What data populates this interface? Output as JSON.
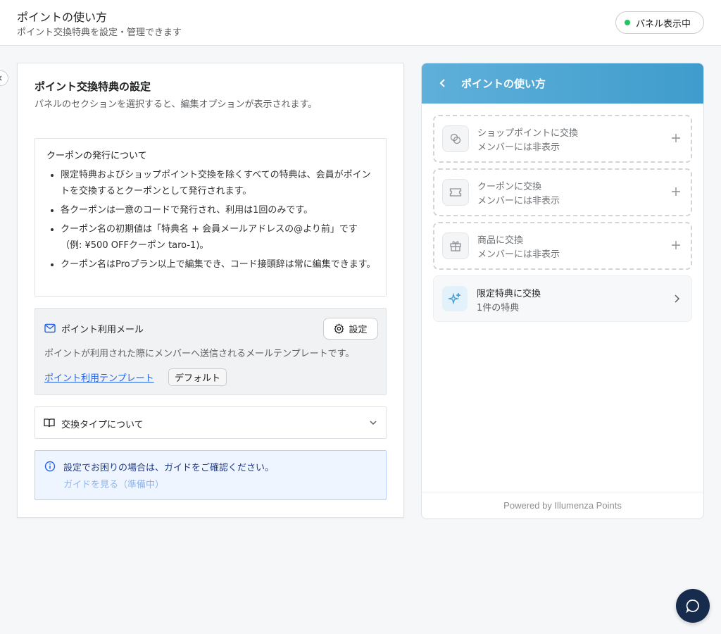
{
  "topbar": {
    "title": "ポイントの使い方",
    "subtitle": "ポイント交換特典を設定・管理できます",
    "status": "パネル表示中",
    "status_color": "#22c55e"
  },
  "settings": {
    "title": "ポイント交換特典の設定",
    "description": "パネルのセクションを選択すると、編集オプションが表示されます。",
    "coupon": {
      "heading": "クーポンの発行について",
      "items": [
        "限定特典およびショップポイント交換を除くすべての特典は、会員がポイントを交換するとクーポンとして発行されます。",
        "各クーポンは一意のコードで発行され、利用は1回のみです。",
        "クーポン名の初期値は「特典名 + 会員メールアドレスの@より前」です（例: ¥500 OFFクーポン taro-1)。",
        "クーポン名はProプラン以上で編集でき、コード接頭辞は常に編集できます。"
      ]
    },
    "email": {
      "icon": "mail-icon",
      "title": "ポイント利用メール",
      "settings_label": "設定",
      "description": "ポイントが利用された際にメンバーへ送信されるメールテンプレートです。",
      "template_link": "ポイント利用テンプレート",
      "badge": "デフォルト"
    },
    "exchange_types": {
      "icon": "book-icon",
      "label": "交換タイプについて"
    },
    "info": {
      "icon": "info-icon",
      "message": "設定でお困りの場合は、ガイドをご確認ください。",
      "guide_link": "ガイドを見る（準備中）"
    }
  },
  "panel": {
    "title": "ポイントの使い方",
    "header_color": "#4ba6d4",
    "methods": [
      {
        "icon": "coins-icon",
        "title": "ショップポイントに交換",
        "status": "メンバーには非表示"
      },
      {
        "icon": "ticket-icon",
        "title": "クーポンに交換",
        "status": "メンバーには非表示"
      },
      {
        "icon": "gift-icon",
        "title": "商品に交換",
        "status": "メンバーには非表示"
      }
    ],
    "special": {
      "icon": "sparkles-icon",
      "title": "限定特典に交換",
      "count": "1件の特典"
    },
    "footer": "Powered by Illumenza Points"
  }
}
